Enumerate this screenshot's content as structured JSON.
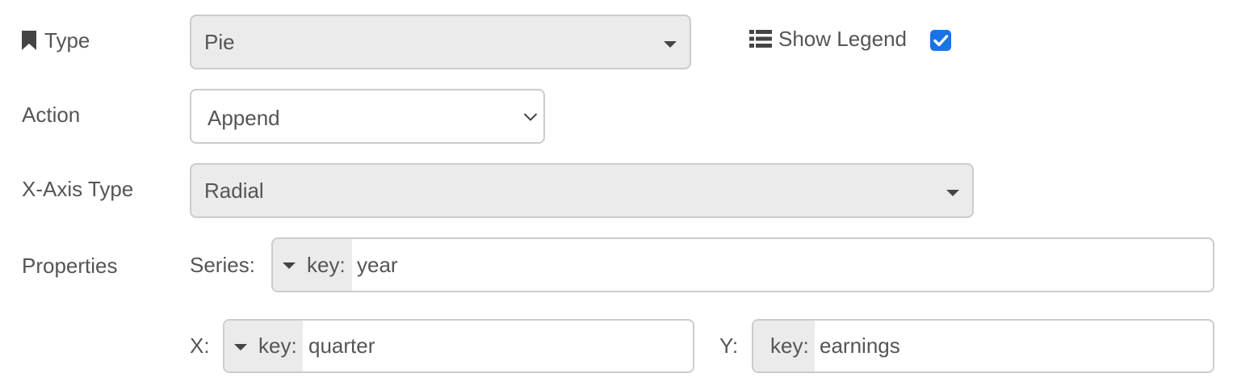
{
  "type_row": {
    "label": "Type",
    "label_icon": "bookmark-icon",
    "value": "Pie"
  },
  "legend": {
    "label": "Show Legend",
    "icon": "list-icon",
    "checked": true,
    "checkbox_color": "#1a73e8"
  },
  "action_row": {
    "label": "Action",
    "value": "Append"
  },
  "xaxis_row": {
    "label": "X-Axis Type",
    "value": "Radial"
  },
  "properties": {
    "label": "Properties",
    "series": {
      "label": "Series:",
      "prefix": "key:",
      "value": "year"
    },
    "x": {
      "label": "X:",
      "prefix": "key:",
      "value": "quarter"
    },
    "y": {
      "label": "Y:",
      "prefix": "key:",
      "value": "earnings"
    }
  }
}
